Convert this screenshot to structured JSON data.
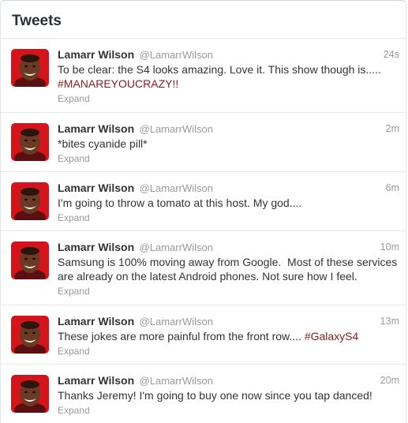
{
  "header": {
    "title": "Tweets"
  },
  "colors": {
    "hashtag": "#8b1a1a",
    "avatar_bg": "#d3141b"
  },
  "tweets": [
    {
      "name": "Lamarr Wilson",
      "handle": "@LamarrWilson",
      "time": "24s",
      "text": "To be clear: the S4 looks amazing. Love it. This show though is.....",
      "hashtag": "#MANAREYOUCRAZY!!",
      "expand": "Expand"
    },
    {
      "name": "Lamarr Wilson",
      "handle": "@LamarrWilson",
      "time": "2m",
      "text": "*bites cyanide pill*",
      "expand": "Expand"
    },
    {
      "name": "Lamarr Wilson",
      "handle": "@LamarrWilson",
      "time": "6m",
      "text": "I'm going to throw a tomato at this host. My god....",
      "expand": "Expand"
    },
    {
      "name": "Lamarr Wilson",
      "handle": "@LamarrWilson",
      "time": "10m",
      "text": "Samsung is 100% moving away from Google.  Most of these services are already on the latest Android phones. Not sure how I feel.",
      "expand": "Expand"
    },
    {
      "name": "Lamarr Wilson",
      "handle": "@LamarrWilson",
      "time": "13m",
      "text": "These jokes are more painful from the front row....",
      "hashtag": "#GalaxyS4",
      "expand": "Expand"
    },
    {
      "name": "Lamarr Wilson",
      "handle": "@LamarrWilson",
      "time": "20m",
      "text": "Thanks Jeremy! I'm going to buy one now since you tap danced!",
      "expand": "Expand"
    }
  ]
}
